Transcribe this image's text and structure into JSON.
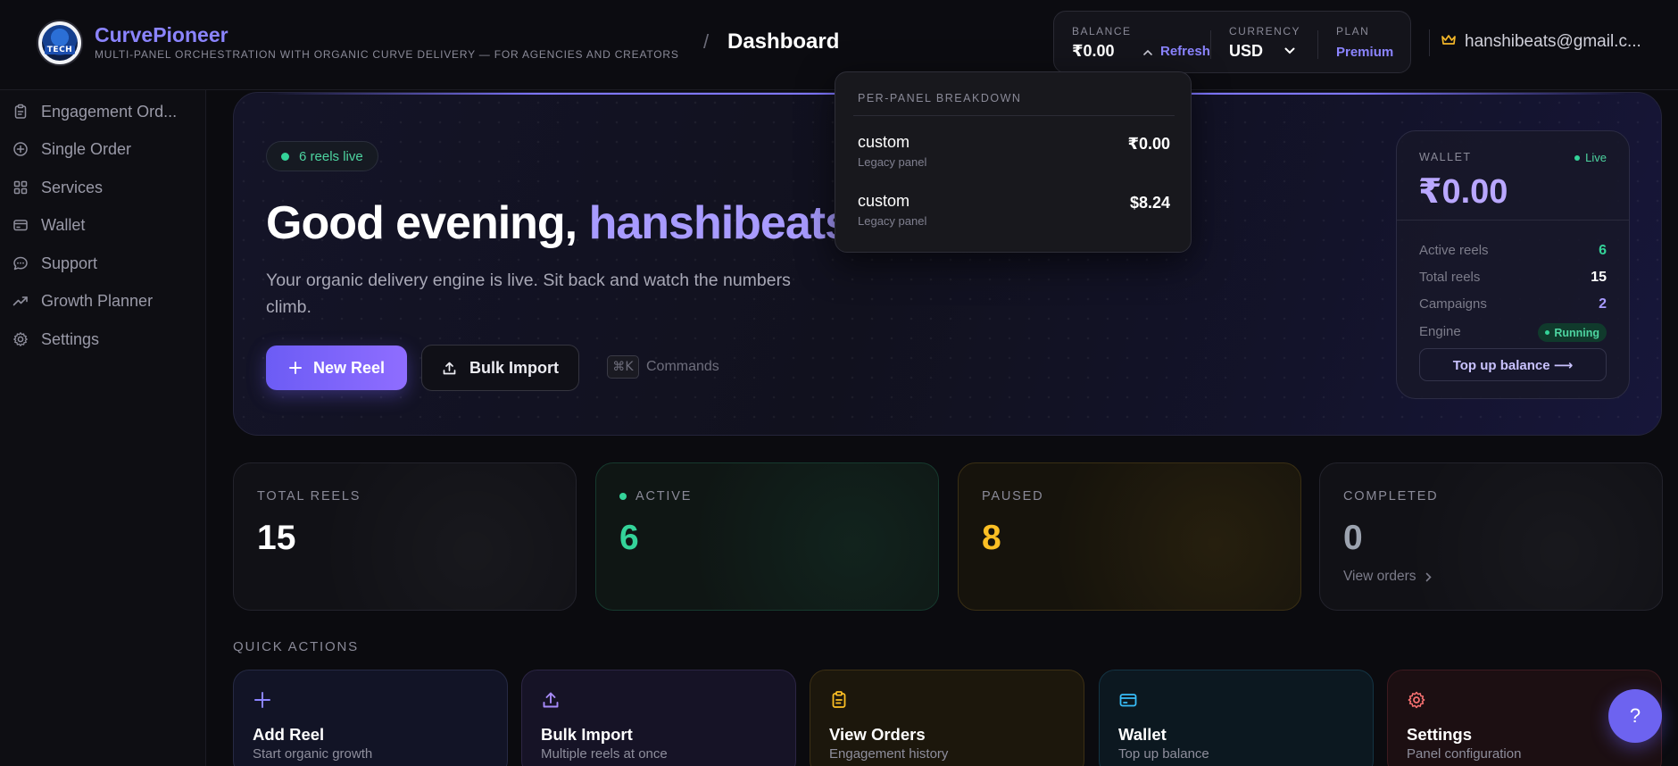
{
  "header": {
    "brand_name": "CurvePioneer",
    "brand_tagline": "MULTI-PANEL ORCHESTRATION WITH ORGANIC CURVE DELIVERY — FOR AGENCIES AND CREATORS",
    "logo_text": "TECH",
    "breadcrumb_sep": "/",
    "page_title": "Dashboard",
    "balance_label": "BALANCE",
    "balance_value": "₹0.00",
    "refresh_label": "Refresh",
    "currency_label": "CURRENCY",
    "currency_value": "USD",
    "plan_label": "PLAN",
    "plan_value": "Premium",
    "email": "hanshibeats@gmail.c..."
  },
  "sidebar": {
    "items": [
      {
        "label": "Engagement Ord...",
        "icon": "clipboard-icon"
      },
      {
        "label": "Single Order",
        "icon": "plus-circle-icon"
      },
      {
        "label": "Services",
        "icon": "grid-icon"
      },
      {
        "label": "Wallet",
        "icon": "wallet-icon"
      },
      {
        "label": "Support",
        "icon": "chat-icon"
      },
      {
        "label": "Growth Planner",
        "icon": "trending-up-icon"
      },
      {
        "label": "Settings",
        "icon": "gear-icon"
      }
    ]
  },
  "hero": {
    "live_pill": "6 reels live",
    "greeting_prefix": "Good evening, ",
    "greeting_name": "hanshibeats",
    "subtitle": "Your organic delivery engine is live. Sit back and watch the numbers climb.",
    "new_reel_label": "New Reel",
    "bulk_import_label": "Bulk Import",
    "command_key": "⌘K",
    "command_label": "Commands"
  },
  "wallet_card": {
    "label": "WALLET",
    "live_label": "Live",
    "amount": "₹0.00",
    "rows": [
      {
        "label": "Active reels",
        "value": "6"
      },
      {
        "label": "Total reels",
        "value": "15"
      },
      {
        "label": "Campaigns",
        "value": "2"
      },
      {
        "label": "Engine",
        "value": "Running"
      }
    ],
    "topup_label": "Top up balance ⟶"
  },
  "breakdown": {
    "title": "PER-PANEL BREAKDOWN",
    "rows": [
      {
        "name": "custom",
        "sub": "Legacy panel",
        "value": "₹0.00"
      },
      {
        "name": "custom",
        "sub": "Legacy panel",
        "value": "$8.24"
      }
    ]
  },
  "stats": [
    {
      "label": "TOTAL REELS",
      "value": "15",
      "color": "#ffffff"
    },
    {
      "label": "ACTIVE",
      "value": "6",
      "color": "#34d399"
    },
    {
      "label": "PAUSED",
      "value": "8",
      "color": "#fbbf24"
    },
    {
      "label": "COMPLETED",
      "value": "0",
      "color": "#9ca3af",
      "link": "View orders"
    }
  ],
  "quick_actions": {
    "title": "QUICK ACTIONS",
    "items": [
      {
        "name": "Add Reel",
        "desc": "Start organic growth",
        "icon": "plus-icon",
        "accent": "#8b84ff"
      },
      {
        "name": "Bulk Import",
        "desc": "Multiple reels at once",
        "icon": "upload-icon",
        "accent": "#a78bfa"
      },
      {
        "name": "View Orders",
        "desc": "Engagement history",
        "icon": "clipboard-icon",
        "accent": "#fbbf24"
      },
      {
        "name": "Wallet",
        "desc": "Top up balance",
        "icon": "wallet-icon",
        "accent": "#38bdf8"
      },
      {
        "name": "Settings",
        "desc": "Panel configuration",
        "icon": "gear-icon",
        "accent": "#f87171"
      }
    ]
  },
  "help_label": "?"
}
